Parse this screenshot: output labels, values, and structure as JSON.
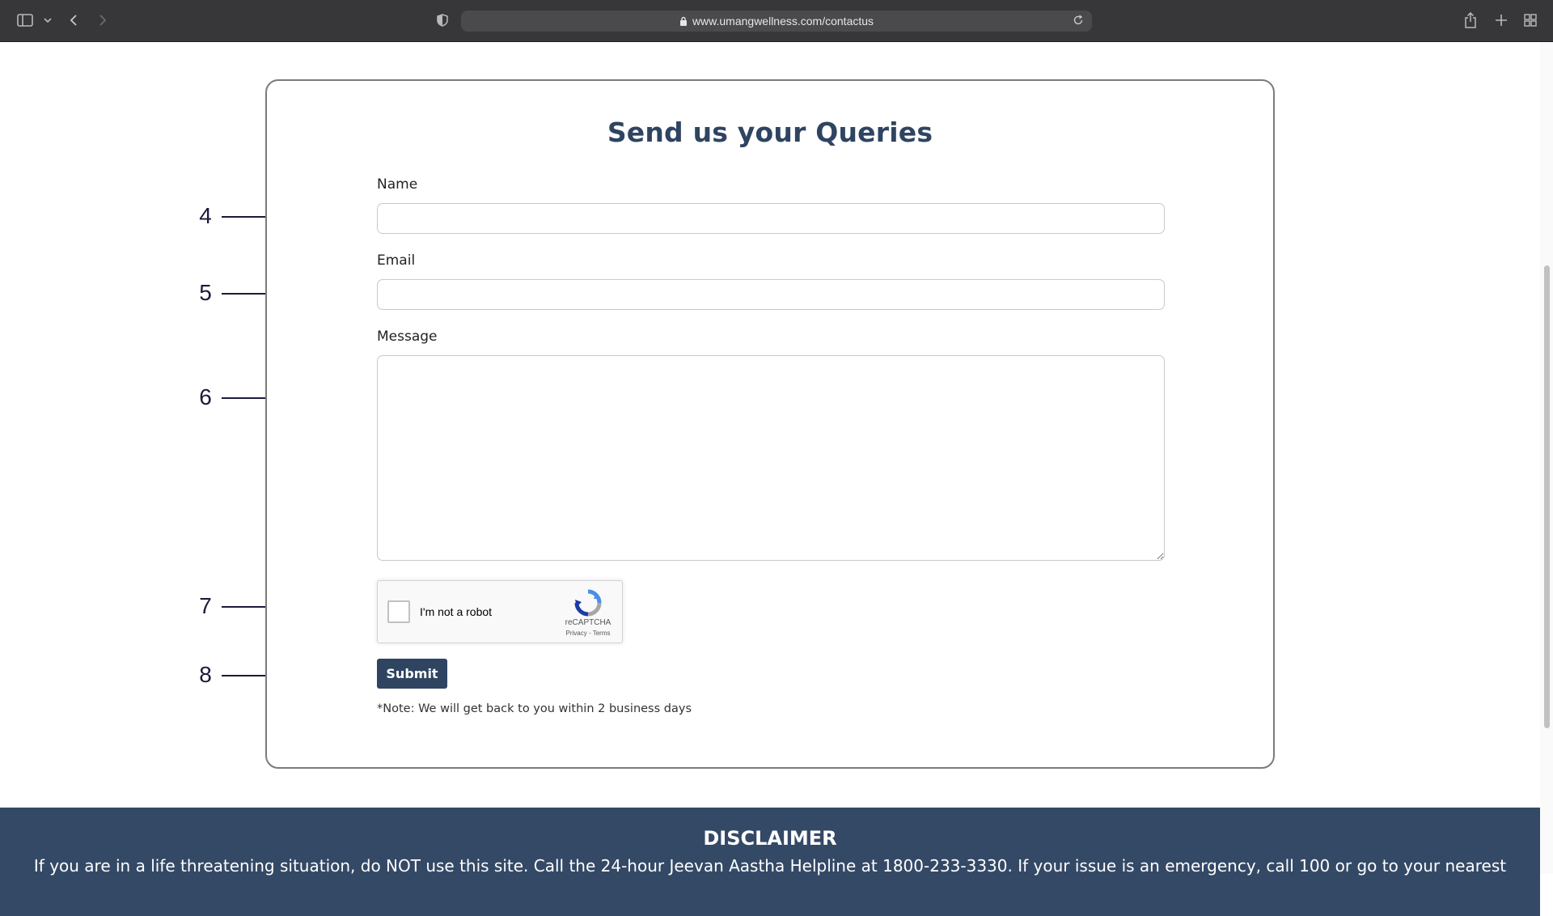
{
  "browser": {
    "url": "www.umangwellness.com/contactus"
  },
  "form": {
    "title": "Send us your Queries",
    "name_label": "Name",
    "name_value": "",
    "email_label": "Email",
    "email_value": "",
    "message_label": "Message",
    "message_value": "",
    "captcha_label": "I'm not a robot",
    "captcha_brand": "reCAPTCHA",
    "captcha_links": "Privacy - Terms",
    "submit_label": "Submit",
    "note": "*Note: We will get back to you within 2 business days"
  },
  "annotations": [
    "4",
    "5",
    "6",
    "7",
    "8"
  ],
  "footer": {
    "title": "DISCLAIMER",
    "text": "If you are in a life threatening situation, do NOT use this site. Call the 24-hour Jeevan Aastha Helpline at 1800-233-3330. If your issue is an emergency, call 100 or go to your nearest"
  },
  "colors": {
    "brand": "#2e4461",
    "footer_bg": "#344966",
    "toolbar_bg": "#37373a"
  }
}
